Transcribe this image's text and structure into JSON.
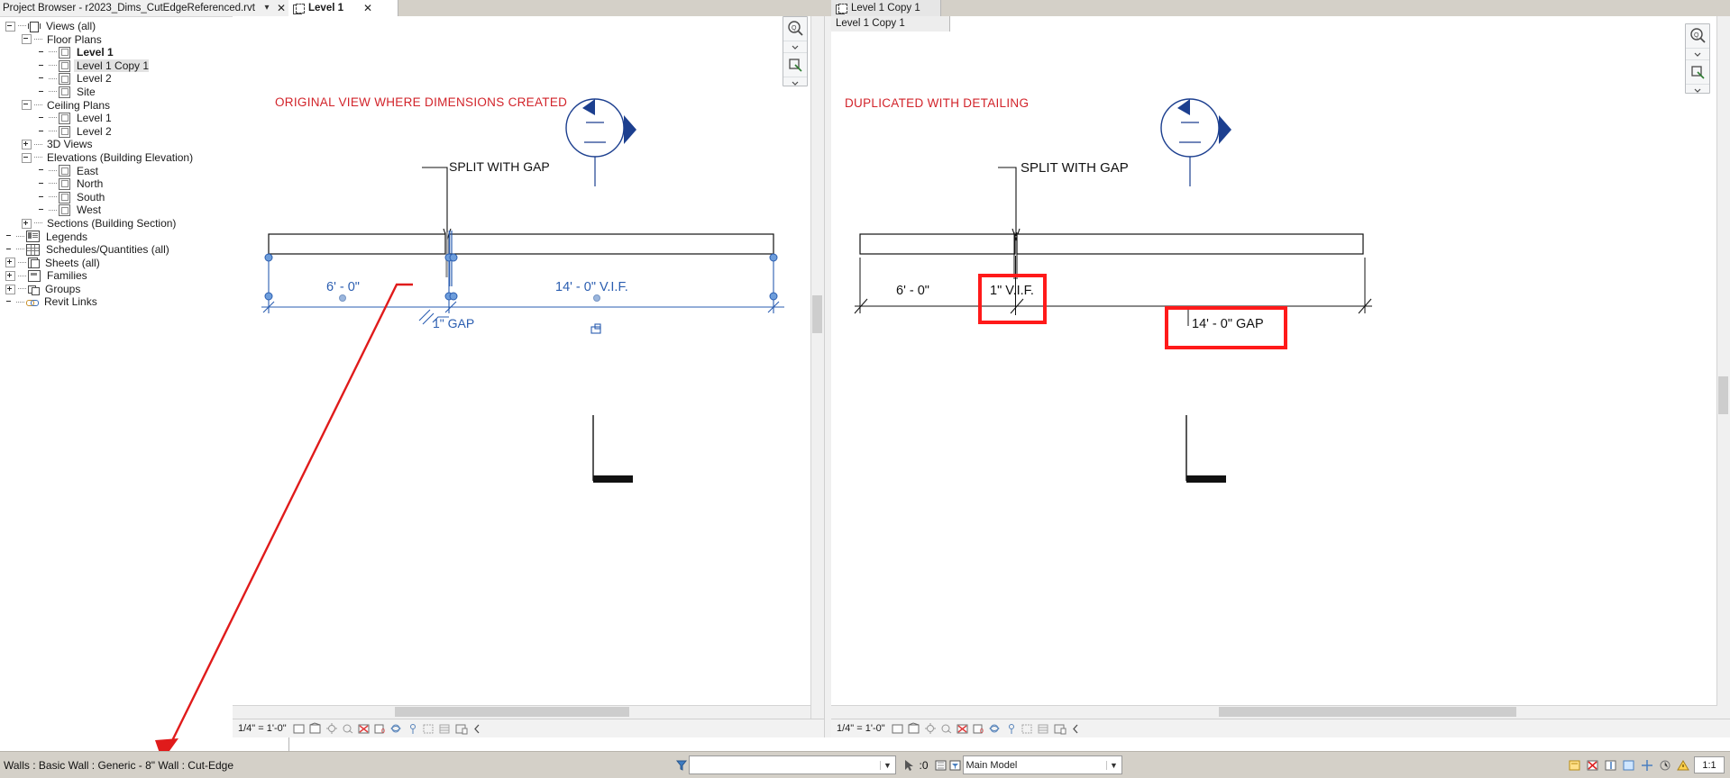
{
  "browser": {
    "title": "Project Browser - r2023_Dims_CutEdgeReferenced.rvt",
    "close_label": "✕",
    "items": [
      {
        "label": "Views (all)",
        "depth": 0,
        "expander": "minus",
        "icon": "views-all-icon",
        "selected": false,
        "bold": false
      },
      {
        "label": "Floor Plans",
        "depth": 1,
        "expander": "minus",
        "icon": "none",
        "selected": false,
        "bold": false
      },
      {
        "label": "Level 1",
        "depth": 2,
        "expander": "none",
        "icon": "view-icon",
        "selected": false,
        "bold": true
      },
      {
        "label": "Level 1 Copy 1",
        "depth": 2,
        "expander": "none",
        "icon": "view-icon",
        "selected": true,
        "bold": false
      },
      {
        "label": "Level 2",
        "depth": 2,
        "expander": "none",
        "icon": "view-icon",
        "selected": false,
        "bold": false
      },
      {
        "label": "Site",
        "depth": 2,
        "expander": "none",
        "icon": "view-icon",
        "selected": false,
        "bold": false
      },
      {
        "label": "Ceiling Plans",
        "depth": 1,
        "expander": "minus",
        "icon": "none",
        "selected": false,
        "bold": false
      },
      {
        "label": "Level 1",
        "depth": 2,
        "expander": "none",
        "icon": "view-icon",
        "selected": false,
        "bold": false
      },
      {
        "label": "Level 2",
        "depth": 2,
        "expander": "none",
        "icon": "view-icon",
        "selected": false,
        "bold": false
      },
      {
        "label": "3D Views",
        "depth": 1,
        "expander": "plus",
        "icon": "none",
        "selected": false,
        "bold": false
      },
      {
        "label": "Elevations (Building Elevation)",
        "depth": 1,
        "expander": "minus",
        "icon": "none",
        "selected": false,
        "bold": false
      },
      {
        "label": "East",
        "depth": 2,
        "expander": "none",
        "icon": "view-icon",
        "selected": false,
        "bold": false
      },
      {
        "label": "North",
        "depth": 2,
        "expander": "none",
        "icon": "view-icon",
        "selected": false,
        "bold": false
      },
      {
        "label": "South",
        "depth": 2,
        "expander": "none",
        "icon": "view-icon",
        "selected": false,
        "bold": false
      },
      {
        "label": "West",
        "depth": 2,
        "expander": "none",
        "icon": "view-icon",
        "selected": false,
        "bold": false
      },
      {
        "label": "Sections (Building Section)",
        "depth": 1,
        "expander": "plus",
        "icon": "none",
        "selected": false,
        "bold": false
      },
      {
        "label": "Legends",
        "depth": 0,
        "expander": "none",
        "icon": "legend-icon",
        "selected": false,
        "bold": false
      },
      {
        "label": "Schedules/Quantities (all)",
        "depth": 0,
        "expander": "none",
        "icon": "schedule-icon",
        "selected": false,
        "bold": false
      },
      {
        "label": "Sheets (all)",
        "depth": 0,
        "expander": "plus",
        "icon": "sheet-icon",
        "selected": false,
        "bold": false
      },
      {
        "label": "Families",
        "depth": 0,
        "expander": "plus",
        "icon": "families-icon",
        "selected": false,
        "bold": false
      },
      {
        "label": "Groups",
        "depth": 0,
        "expander": "plus",
        "icon": "groups-icon",
        "selected": false,
        "bold": false
      },
      {
        "label": "Revit Links",
        "depth": 0,
        "expander": "none",
        "icon": "revit-links-icon",
        "selected": false,
        "bold": false
      }
    ]
  },
  "tabs": [
    {
      "label": "Level 1",
      "active": true,
      "close_label": "✕"
    },
    {
      "label": "Level 1 Copy 1",
      "active": false,
      "close_label": ""
    }
  ],
  "left_view": {
    "tab_label": "Level 1",
    "heading": "ORIGINAL VIEW WHERE DIMENSIONS CREATED",
    "heading_color": "#d2232a",
    "callout_label": "SPLIT WITH GAP",
    "dim_left": "6' - 0\"",
    "dim_right": "14' - 0\" V.I.F.",
    "gap_label": "1\" GAP",
    "scale": "1/4\" = 1'-0\"",
    "selection_color": "#2a5db0"
  },
  "right_view": {
    "tab_label": "Level 1 Copy 1",
    "heading": "DUPLICATED WITH DETAILING",
    "heading_color": "#d2232a",
    "callout_label": "SPLIT WITH GAP",
    "dim_left": "6' - 0\"",
    "dim_mid": "1\" V.I.F.",
    "dim_right": "14' - 0\" GAP",
    "highlight_color": "#ff1a1a",
    "scale": "1/4\" = 1'-0\""
  },
  "status_bar": {
    "message": "Walls : Basic Wall : Generic - 8\" Wall : Cut-Edge",
    "filter_value": "",
    "filter_placeholder": "",
    "selection_count": ":0",
    "workset_value": "Main Model",
    "zoom_value": "1:1"
  },
  "view_controls": {
    "items": [
      "scale-label",
      "detail-level-icon",
      "visual-style-icon",
      "sun-path-icon",
      "shadows-icon",
      "render-dialog-icon",
      "crop-view-icon",
      "show-crop-icon",
      "lock-3d-view-icon",
      "temp-hide-isolate-icon",
      "reveal-hidden-icon",
      "temporary-view-icon",
      "analytical-model-icon",
      "chevron-left-icon"
    ]
  }
}
